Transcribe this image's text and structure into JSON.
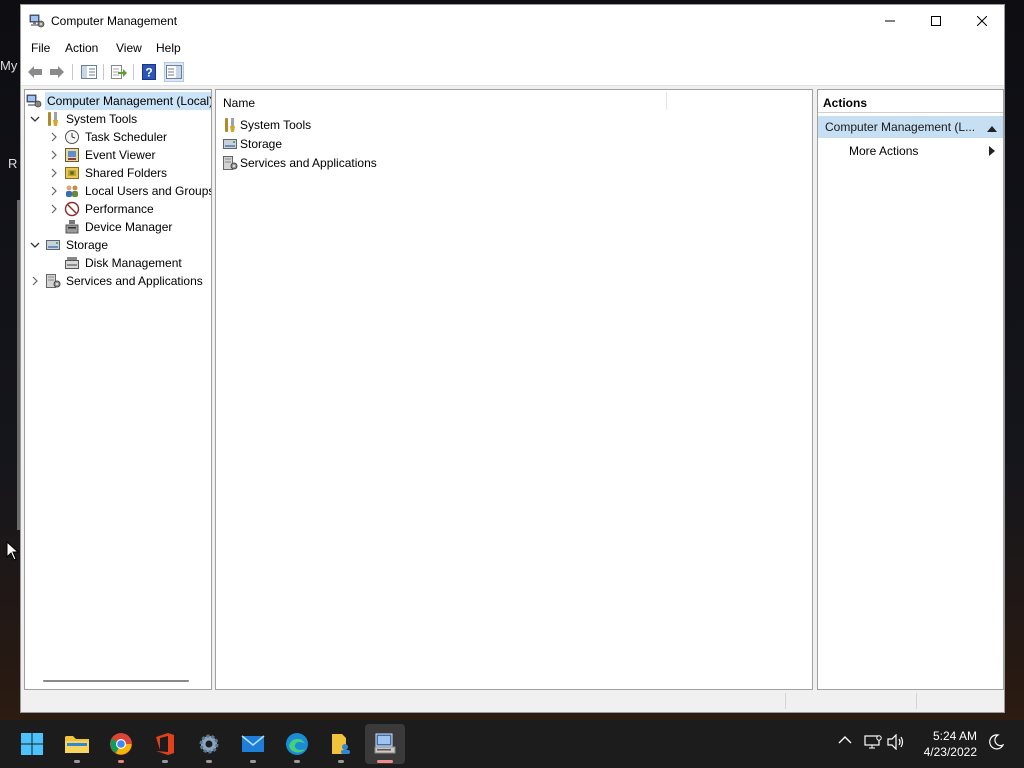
{
  "desktop": {
    "text_1": "My",
    "text_2": "R"
  },
  "window": {
    "title": "Computer Management",
    "controls": {
      "minimize": "minimize",
      "maximize": "maximize",
      "close": "close"
    }
  },
  "menu": {
    "file": "File",
    "action": "Action",
    "view": "View",
    "help": "Help"
  },
  "tree": {
    "root": "Computer Management (Local)",
    "system_tools": "System Tools",
    "task_scheduler": "Task Scheduler",
    "event_viewer": "Event Viewer",
    "shared_folders": "Shared Folders",
    "local_users": "Local Users and Groups",
    "performance": "Performance",
    "device_manager": "Device Manager",
    "storage": "Storage",
    "disk_management": "Disk Management",
    "services_apps": "Services and Applications"
  },
  "list": {
    "column_name": "Name",
    "items": [
      "System Tools",
      "Storage",
      "Services and Applications"
    ]
  },
  "actions": {
    "title": "Actions",
    "section": "Computer Management (L...",
    "more_actions": "More Actions"
  },
  "clock": {
    "time": "5:24 AM",
    "date": "4/23/2022"
  },
  "colors": {
    "selection": "#cce4f7",
    "actions_section": "#c7dff3",
    "taskbar": "#1c1c1c"
  }
}
